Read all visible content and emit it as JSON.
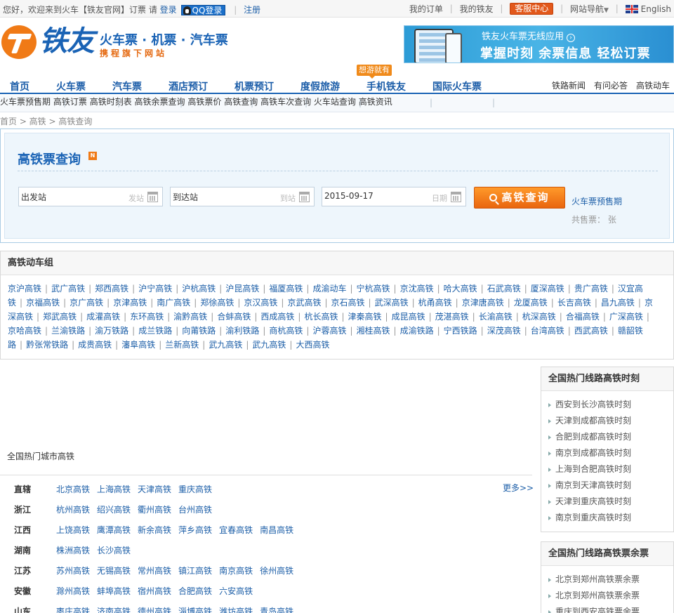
{
  "topbar": {
    "greeting": "您好，欢迎来到火车【铁友官网】订票  请",
    "login": "登录",
    "qq_login": "QQ登录",
    "register": "注册",
    "my_orders": "我的订单",
    "my_tieyou": "我的铁友",
    "service": "客服中心",
    "site_nav": "网站导航",
    "language": "English"
  },
  "logo": {
    "name": "铁友",
    "slogan": "火车票 · 机票 · 汽车票",
    "sub": "携程旗下网站"
  },
  "banner": {
    "line1": "铁友火车票无线应用",
    "line2": "掌握时刻  余票信息  轻松订票"
  },
  "mainnav": {
    "items": [
      "首页",
      "火车票",
      "汽车票",
      "酒店预订",
      "机票预订",
      "度假旅游",
      "手机铁友",
      "国际火车票"
    ],
    "tag": "想游就有",
    "right": [
      "铁路新闻",
      "有问必答",
      "高铁动车"
    ]
  },
  "subnav": [
    "火车票预售期",
    "高铁订票",
    "高铁时刻表",
    "高铁余票查询",
    "高铁票价",
    "高铁查询",
    "高铁车次查询",
    "火车站查询",
    "高铁资讯"
  ],
  "breadcrumb": "首页 > 高铁 > 高铁查询",
  "search": {
    "title": "高铁票查询",
    "new_badge": "N",
    "from_value": "出发站",
    "from_hint": "发站",
    "to_value": "到达站",
    "to_hint": "到站",
    "date_value": "2015-09-17",
    "date_hint": "日期",
    "button": "高铁查询",
    "presale_link": "火车票预售期",
    "sold": "共售票：  张"
  },
  "groups": {
    "title": "高铁动车组",
    "items": [
      "京沪高铁",
      "武广高铁",
      "郑西高铁",
      "沪宁高铁",
      "沪杭高铁",
      "沪昆高铁",
      "福厦高铁",
      "成渝动车",
      "宁杭高铁",
      "京沈高铁",
      "哈大高铁",
      "石武高铁",
      "厦深高铁",
      "贵广高铁",
      "汉宜高铁",
      "京福高铁",
      "京广高铁",
      "京津高铁",
      "南广高铁",
      "郑徐高铁",
      "京汉高铁",
      "京武高铁",
      "京石高铁",
      "武深高铁",
      "杭甬高铁",
      "京津唐高铁",
      "龙厦高铁",
      "长吉高铁",
      "昌九高铁",
      "京深高铁",
      "郑武高铁",
      "成灌高铁",
      "东环高铁",
      "渝黔高铁",
      "合蚌高铁",
      "西成高铁",
      "杭长高铁",
      "津秦高铁",
      "成昆高铁",
      "茂湛高铁",
      "长渝高铁",
      "杭深高铁",
      "合福高铁",
      "广深高铁",
      "京哈高铁",
      "兰渝铁路",
      "渝万铁路",
      "成兰铁路",
      "向莆铁路",
      "渝利铁路",
      "商杭高铁",
      "沪蓉高铁",
      "湘桂高铁",
      "成渝铁路",
      "宁西铁路",
      "深茂高铁",
      "台湾高铁",
      "西武高铁",
      "赣韶铁路",
      "黔张常铁路",
      "成贵高铁",
      "瀋阜高铁",
      "兰新高铁",
      "武九高铁",
      "武九高铁",
      "大西高铁"
    ]
  },
  "hot": {
    "title": "全国热门城市高铁",
    "more": "更多>>",
    "provinces": [
      {
        "name": "直辖",
        "cities": [
          "北京高铁",
          "上海高铁",
          "天津高铁",
          "重庆高铁"
        ]
      },
      {
        "name": "浙江",
        "cities": [
          "杭州高铁",
          "绍兴高铁",
          "衢州高铁",
          "台州高铁"
        ]
      },
      {
        "name": "江西",
        "cities": [
          "上饶高铁",
          "鹰潭高铁",
          "新余高铁",
          "萍乡高铁",
          "宜春高铁",
          "南昌高铁"
        ]
      },
      {
        "name": "湖南",
        "cities": [
          "株洲高铁",
          "长沙高铁"
        ]
      },
      {
        "name": "江苏",
        "cities": [
          "苏州高铁",
          "无锡高铁",
          "常州高铁",
          "镇江高铁",
          "南京高铁",
          "徐州高铁"
        ]
      },
      {
        "name": "安徽",
        "cities": [
          "滁州高铁",
          "蚌埠高铁",
          "宿州高铁",
          "合肥高铁",
          "六安高铁"
        ]
      },
      {
        "name": "山东",
        "cities": [
          "枣庄高铁",
          "济南高铁",
          "德州高铁",
          "淄博高铁",
          "潍坊高铁",
          "青岛高铁"
        ]
      }
    ]
  },
  "panel1": {
    "title": "全国热门线路高铁时刻",
    "items": [
      "西安到长沙高铁时刻",
      "天津到成都高铁时刻",
      "合肥到成都高铁时刻",
      "南京到成都高铁时刻",
      "上海到合肥高铁时刻",
      "南京到天津高铁时刻",
      "天津到重庆高铁时刻",
      "南京到重庆高铁时刻"
    ]
  },
  "panel2": {
    "title": "全国热门线路高铁票余票",
    "items": [
      "北京到郑州高铁票余票",
      "北京到郑州高铁票余票",
      "重庆到西安高铁票余票"
    ]
  }
}
